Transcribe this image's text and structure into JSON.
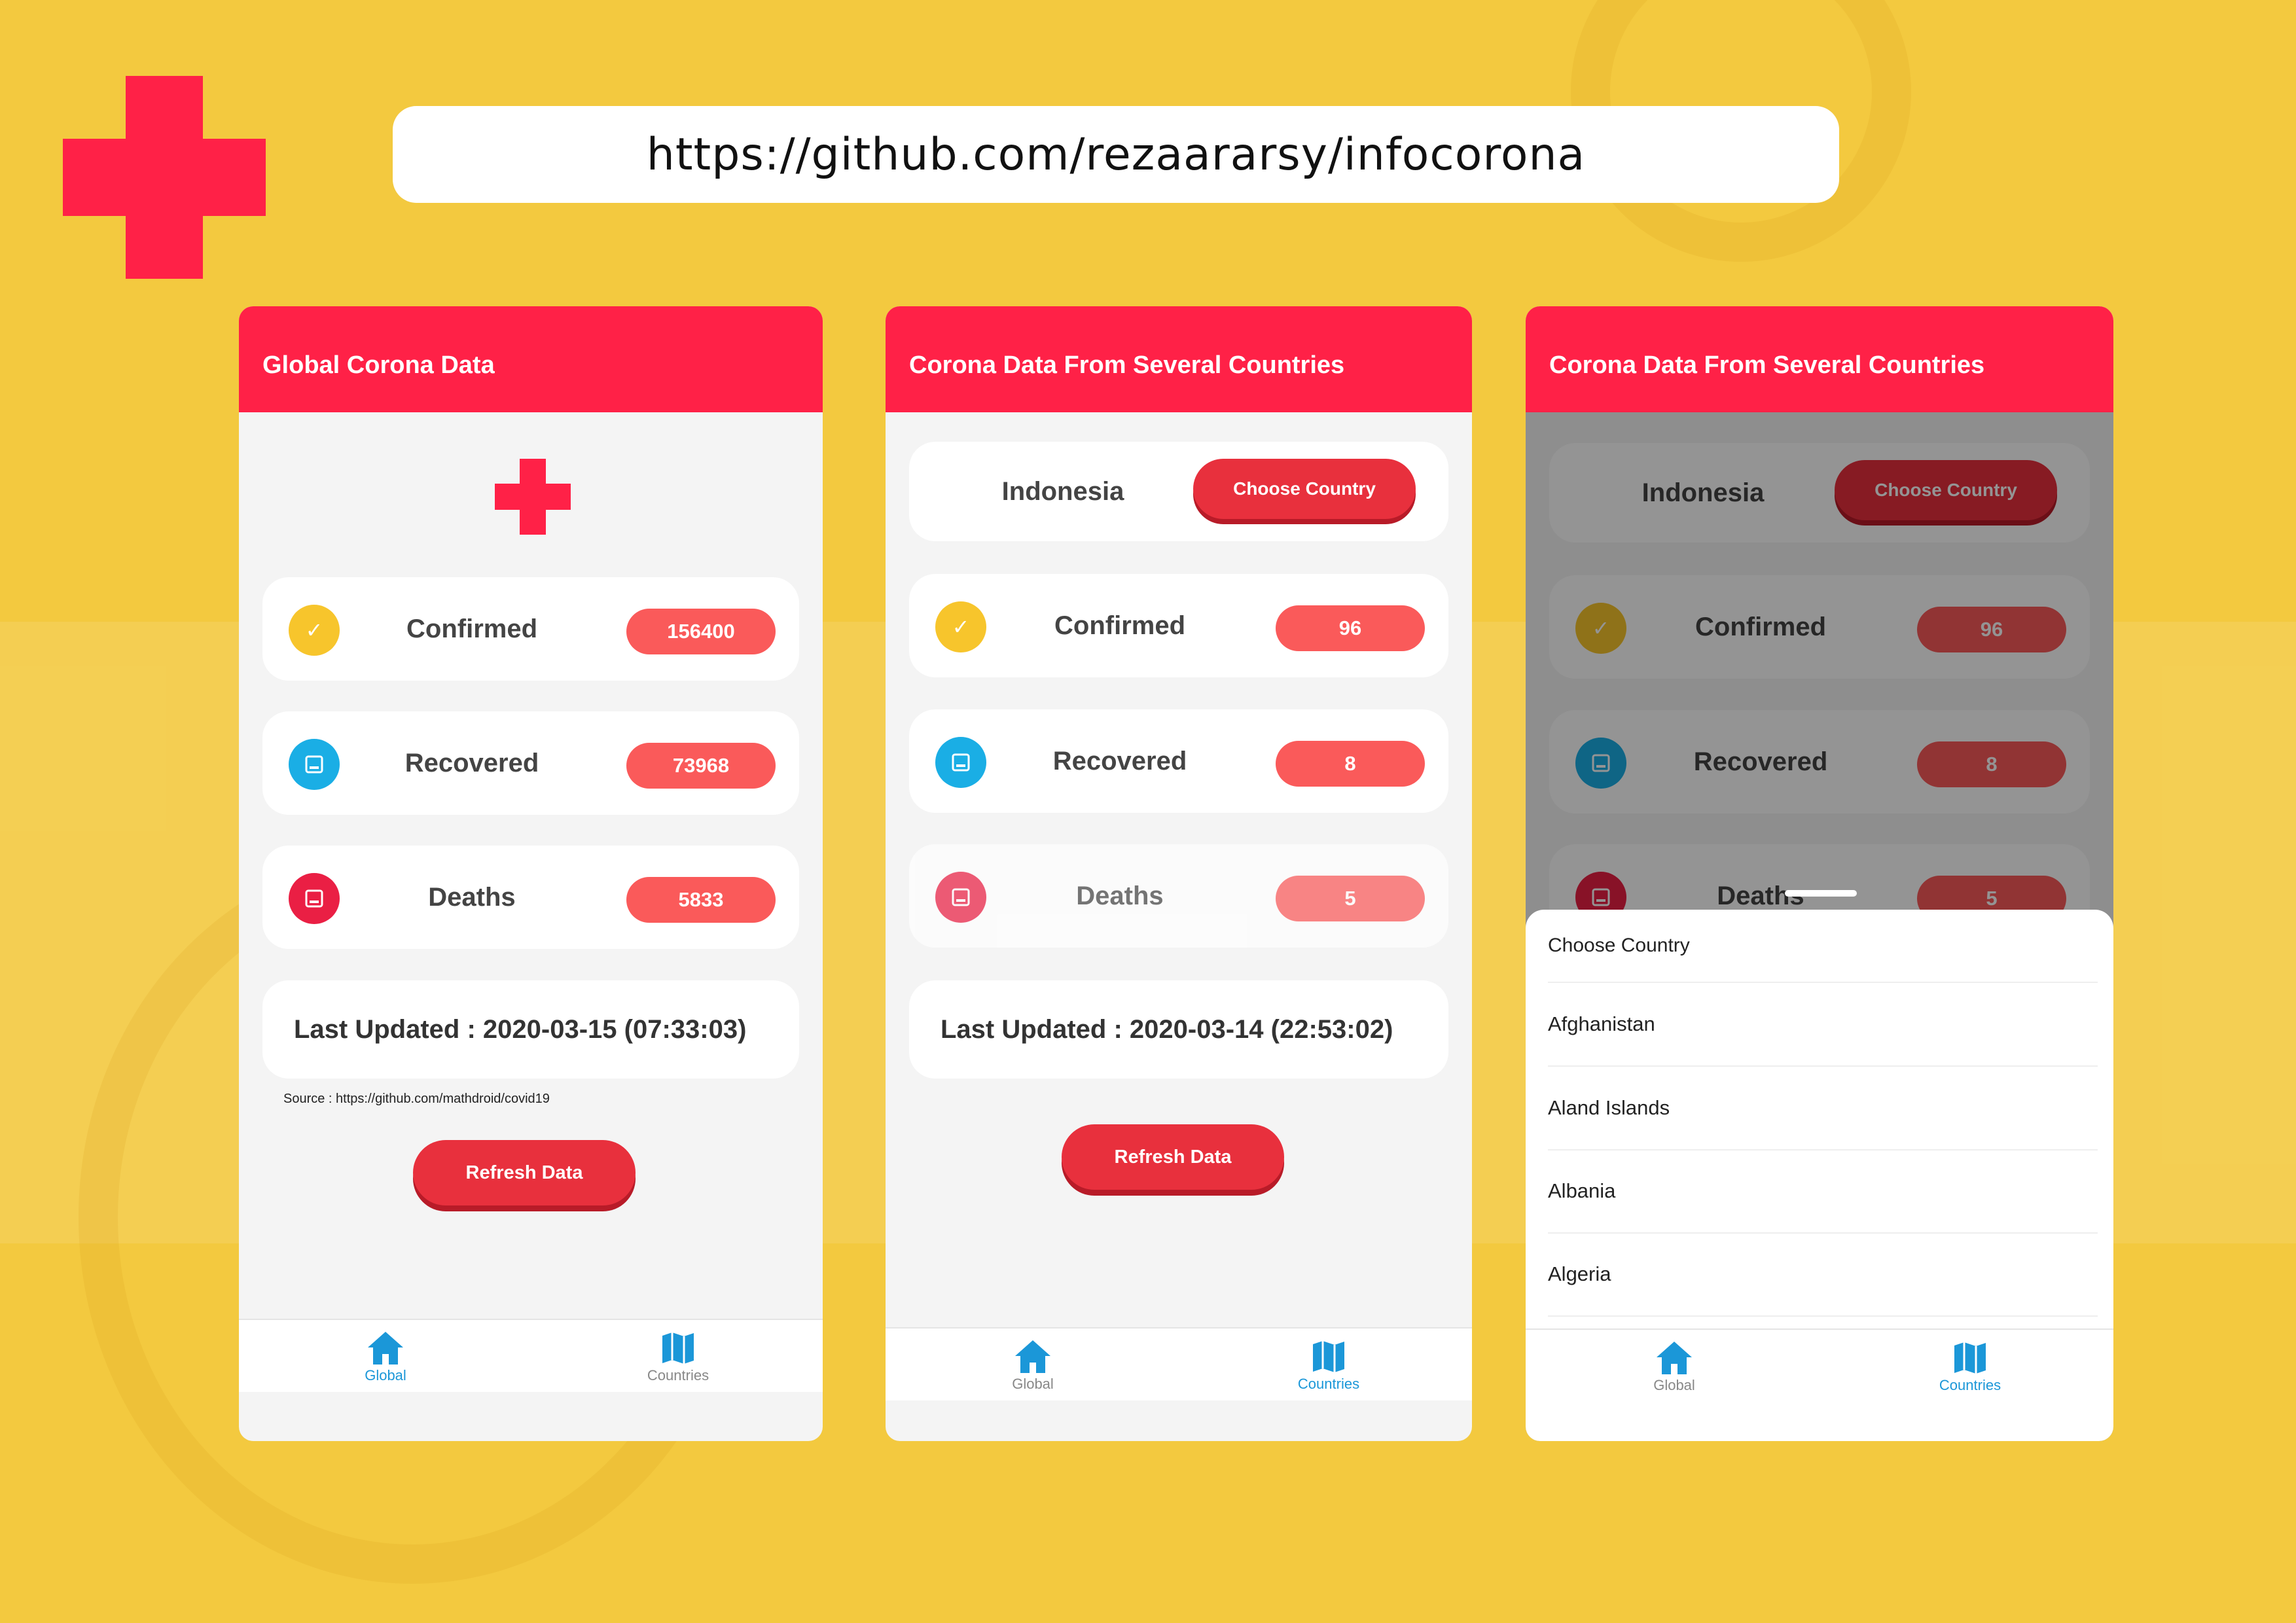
{
  "promo": {
    "url": "https://github.com/rezaararsy/infocorona"
  },
  "colors": {
    "background": "#f3c93f",
    "primary_red": "#ff2147",
    "badge_red": "#fa5a5a",
    "button_red": "#e8303d",
    "confirmed_yellow": "#f7c52c",
    "recovered_blue": "#1aaee5",
    "deaths_red": "#ea1f44",
    "nav_active": "#1b97d8"
  },
  "screen_global": {
    "title": "Global Corona Data",
    "stats": [
      {
        "label": "Confirmed",
        "value": "156400",
        "icon": "check-icon"
      },
      {
        "label": "Recovered",
        "value": "73968",
        "icon": "inbox-icon"
      },
      {
        "label": "Deaths",
        "value": "5833",
        "icon": "inbox-icon"
      }
    ],
    "last_updated": "Last Updated : 2020-03-15 (07:33:03)",
    "source": "Source : https://github.com/mathdroid/covid19",
    "refresh_label": "Refresh Data",
    "nav": [
      {
        "label": "Global",
        "icon": "home-icon",
        "active": true
      },
      {
        "label": "Countries",
        "icon": "map-icon",
        "active": false
      }
    ]
  },
  "screen_countries": {
    "title": "Corona Data From Several Countries",
    "country": "Indonesia",
    "choose_label": "Choose Country",
    "stats": [
      {
        "label": "Confirmed",
        "value": "96",
        "icon": "check-icon"
      },
      {
        "label": "Recovered",
        "value": "8",
        "icon": "inbox-icon"
      },
      {
        "label": "Deaths",
        "value": "5",
        "icon": "inbox-icon"
      }
    ],
    "last_updated": "Last Updated : 2020-03-14 (22:53:02)",
    "refresh_label": "Refresh Data",
    "nav": [
      {
        "label": "Global",
        "icon": "home-icon",
        "active": false
      },
      {
        "label": "Countries",
        "icon": "map-icon",
        "active": true
      }
    ]
  },
  "screen_picker": {
    "title": "Corona Data From Several Countries",
    "country": "Indonesia",
    "choose_label": "Choose Country",
    "stats": [
      {
        "label": "Confirmed",
        "value": "96"
      },
      {
        "label": "Recovered",
        "value": "8"
      },
      {
        "label": "Deaths",
        "value": "5"
      }
    ],
    "sheet_title": "Choose Country",
    "countries": [
      "Afghanistan",
      "Aland Islands",
      "Albania",
      "Algeria"
    ],
    "nav": [
      {
        "label": "Global",
        "icon": "home-icon",
        "active": false
      },
      {
        "label": "Countries",
        "icon": "map-icon",
        "active": true
      }
    ]
  }
}
